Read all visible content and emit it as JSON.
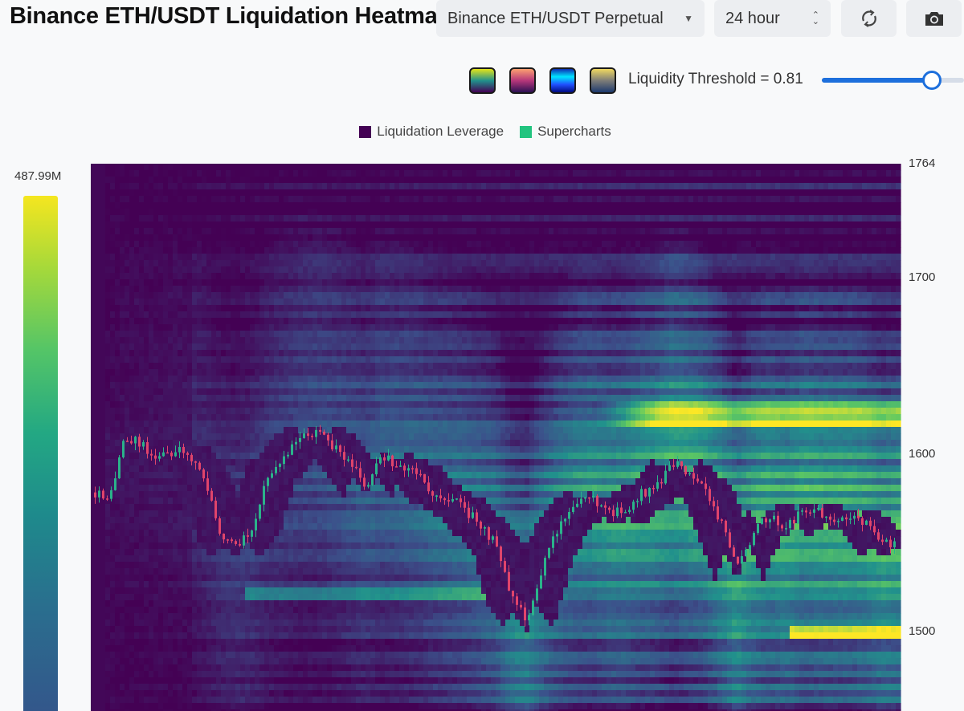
{
  "header": {
    "title": "Binance ETH/USDT Liquidation Heatmap",
    "pair_select": "Binance ETH/USDT Perpetual",
    "period_select": "24 hour"
  },
  "controls": {
    "palettes": [
      "viridis",
      "magma",
      "jet",
      "cividis"
    ],
    "threshold_label": "Liquidity Threshold = 0.81",
    "threshold_value": 0.81,
    "accent_color": "#1d6fdc"
  },
  "icons": {
    "refresh": "refresh-icon",
    "camera": "camera-icon",
    "dropdown": "chevron-down-icon",
    "stepper": "up-down-icon"
  },
  "chart_data": {
    "type": "heatmap",
    "title": "Binance ETH/USDT Liquidation Heatmap",
    "legend": {
      "placement": "top-center",
      "entries": [
        {
          "name": "Liquidation Leverage",
          "color": "#440154"
        },
        {
          "name": "Supercharts",
          "color": "#22c47f"
        }
      ]
    },
    "colorbar": {
      "max_label": "487.99M",
      "max_value": 487990000,
      "colormap": "viridis"
    },
    "y_axis": {
      "range": [
        1455,
        1764
      ],
      "ticks": [
        "1764",
        "1700",
        "1600",
        "1500"
      ]
    },
    "price_path": [
      1580,
      1572,
      1610,
      1606,
      1596,
      1602,
      1600,
      1585,
      1555,
      1548,
      1560,
      1590,
      1600,
      1610,
      1613,
      1604,
      1594,
      1582,
      1598,
      1594,
      1590,
      1580,
      1575,
      1570,
      1560,
      1550,
      1518,
      1507,
      1540,
      1560,
      1572,
      1576,
      1567,
      1568,
      1578,
      1582,
      1595,
      1588,
      1580,
      1560,
      1536,
      1556,
      1566,
      1558,
      1570,
      1568,
      1564,
      1566,
      1560,
      1548,
      1553
    ]
  }
}
